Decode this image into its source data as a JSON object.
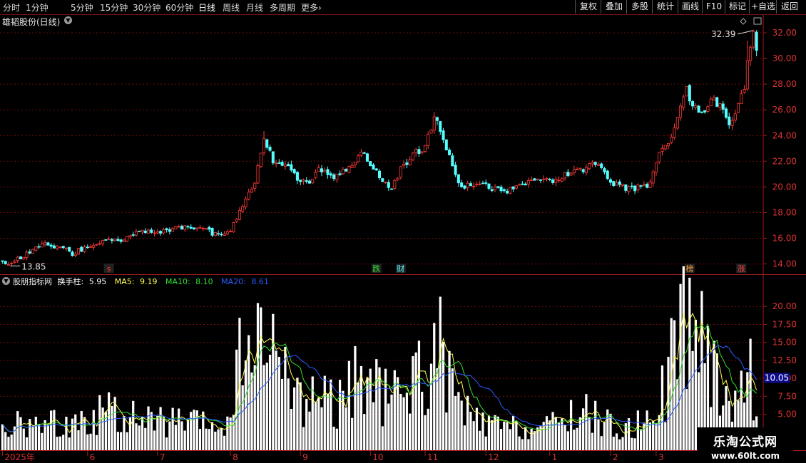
{
  "toolbar": {
    "periods": [
      "分时",
      "1分钟",
      "5分钟",
      "15分钟",
      "30分钟",
      "60分钟",
      "日线",
      "周线",
      "月线",
      "多周期",
      "更多"
    ],
    "active_period": "日线",
    "more_arrow": "›",
    "right_buttons": [
      "复权",
      "叠加",
      "多股",
      "统计",
      "画线",
      "F10",
      "标记",
      "+自选",
      "返回"
    ]
  },
  "stock_title": "雄韬股份(日线)",
  "dropdown_icon": "chevron-down-icon",
  "indicator": {
    "source": "股朋指标网",
    "name": "换手柱:",
    "value": "5.95",
    "ma5_label": "MA5:",
    "ma5": "9.19",
    "ma10_label": "MA10:",
    "ma10": "8.10",
    "ma20_label": "MA20:",
    "ma20": "8.61"
  },
  "watermark": {
    "name": "乐淘公式网",
    "url": "www.60lt.com"
  },
  "colors": {
    "up": "#ff3b3b",
    "down": "#54ffff",
    "grid": "#6e0d0d",
    "axis": "#a51c1c",
    "ma5": "#ffff55",
    "ma10": "#33dd33",
    "ma20": "#2a5bff",
    "bar": "#ffffff"
  },
  "chart_data": [
    {
      "type": "candlestick",
      "title": "雄韬股份(日线)",
      "ylim": [
        13.2,
        33.0
      ],
      "y_ticks": [
        "32.00",
        "30.00",
        "28.00",
        "26.00",
        "24.00",
        "22.00",
        "20.00",
        "18.00",
        "16.00",
        "14.00"
      ],
      "y_tick_values": [
        32,
        30,
        28,
        26,
        24,
        22,
        20,
        18,
        16,
        14
      ],
      "x_ticks": [
        "2025年",
        "6",
        "7",
        "8",
        "9",
        "10",
        "11",
        "12",
        "1",
        "2",
        "3"
      ],
      "x_tick_index": [
        0,
        28,
        51,
        75,
        98,
        121,
        139,
        159,
        180,
        200,
        215
      ],
      "max_label": "32.39",
      "min_label": "13.85",
      "markers": [
        {
          "index": 35,
          "label": "s",
          "color": "#ff3b3b"
        },
        {
          "index": 123,
          "label": "跌",
          "color": "#33dd33"
        },
        {
          "index": 131,
          "label": "财",
          "color": "#54ffff"
        },
        {
          "index": 226,
          "label": "榜",
          "color": "#ff9f3b"
        },
        {
          "index": 243,
          "label": "涨",
          "color": "#ff3b3b"
        }
      ],
      "anchors": [
        [
          0,
          14.2
        ],
        [
          2,
          13.9
        ],
        [
          8,
          14.8
        ],
        [
          14,
          15.6
        ],
        [
          20,
          15.2
        ],
        [
          23,
          14.8
        ],
        [
          28,
          15.4
        ],
        [
          34,
          15.9
        ],
        [
          40,
          15.9
        ],
        [
          46,
          16.6
        ],
        [
          52,
          16.5
        ],
        [
          58,
          16.8
        ],
        [
          64,
          16.8
        ],
        [
          72,
          16.2
        ],
        [
          75,
          16.6
        ],
        [
          79,
          18.5
        ],
        [
          83,
          20.5
        ],
        [
          86,
          23.8
        ],
        [
          89,
          22.0
        ],
        [
          92,
          21.8
        ],
        [
          95,
          21.5
        ],
        [
          98,
          20.4
        ],
        [
          101,
          20.5
        ],
        [
          104,
          21.5
        ],
        [
          108,
          20.8
        ],
        [
          113,
          21.2
        ],
        [
          118,
          22.8
        ],
        [
          122,
          21.5
        ],
        [
          125,
          20.5
        ],
        [
          128,
          19.8
        ],
        [
          131,
          21.5
        ],
        [
          135,
          22.5
        ],
        [
          139,
          23.2
        ],
        [
          142,
          25.5
        ],
        [
          145,
          23.8
        ],
        [
          148,
          21.5
        ],
        [
          151,
          20.0
        ],
        [
          155,
          20.3
        ],
        [
          160,
          20.0
        ],
        [
          165,
          19.6
        ],
        [
          170,
          20.1
        ],
        [
          175,
          20.6
        ],
        [
          180,
          20.4
        ],
        [
          185,
          20.9
        ],
        [
          190,
          21.3
        ],
        [
          193,
          21.7
        ],
        [
          197,
          21.5
        ],
        [
          201,
          20.2
        ],
        [
          206,
          19.9
        ],
        [
          210,
          19.9
        ],
        [
          213,
          20.3
        ],
        [
          216,
          22.5
        ],
        [
          220,
          24.0
        ],
        [
          223,
          26.5
        ],
        [
          225,
          27.8
        ],
        [
          227,
          26.2
        ],
        [
          230,
          25.6
        ],
        [
          233,
          26.8
        ],
        [
          236,
          26.5
        ],
        [
          239,
          25.0
        ],
        [
          242,
          26.5
        ],
        [
          244,
          27.5
        ],
        [
          245,
          29.5
        ],
        [
          247,
          31.8
        ],
        [
          248,
          30.8
        ]
      ]
    },
    {
      "type": "bar",
      "title": "换手柱",
      "ylim": [
        0,
        22.5
      ],
      "y_ticks": [
        "20.00",
        "17.50",
        "15.00",
        "12.50",
        "10.00",
        "7.50",
        "5.00"
      ],
      "y_tick_values": [
        20,
        17.5,
        15,
        12.5,
        10,
        7.5,
        5
      ],
      "current_value_label": "10.05",
      "current_value": 10.05,
      "series": [
        {
          "name": "MA5",
          "color": "#ffff55",
          "period": 5
        },
        {
          "name": "MA10",
          "color": "#33dd33",
          "period": 10
        },
        {
          "name": "MA20",
          "color": "#2a5bff",
          "period": 20
        }
      ],
      "anchors": [
        [
          0,
          3.5
        ],
        [
          10,
          3.0
        ],
        [
          20,
          3.6
        ],
        [
          30,
          4.0
        ],
        [
          35,
          5.4
        ],
        [
          40,
          4.3
        ],
        [
          50,
          3.8
        ],
        [
          60,
          3.5
        ],
        [
          70,
          3.2
        ],
        [
          75,
          3.5
        ],
        [
          78,
          11.5
        ],
        [
          80,
          15.0
        ],
        [
          83,
          13.5
        ],
        [
          86,
          12.0
        ],
        [
          90,
          11.0
        ],
        [
          95,
          8.5
        ],
        [
          100,
          6.8
        ],
        [
          105,
          7.8
        ],
        [
          110,
          5.8
        ],
        [
          113,
          6.5
        ],
        [
          117,
          10.0
        ],
        [
          121,
          8.2
        ],
        [
          124,
          7.5
        ],
        [
          128,
          6.5
        ],
        [
          132,
          7.8
        ],
        [
          136,
          10.5
        ],
        [
          140,
          9.5
        ],
        [
          144,
          13.0
        ],
        [
          147,
          9.0
        ],
        [
          150,
          6.0
        ],
        [
          155,
          3.8
        ],
        [
          160,
          3.2
        ],
        [
          170,
          2.8
        ],
        [
          180,
          3.0
        ],
        [
          185,
          4.2
        ],
        [
          190,
          5.2
        ],
        [
          195,
          4.3
        ],
        [
          200,
          3.2
        ],
        [
          205,
          2.5
        ],
        [
          210,
          3.5
        ],
        [
          213,
          5.5
        ],
        [
          218,
          8.0
        ],
        [
          222,
          14.5
        ],
        [
          224,
          19.0
        ],
        [
          226,
          18.0
        ],
        [
          228,
          15.0
        ],
        [
          232,
          12.0
        ],
        [
          236,
          9.0
        ],
        [
          240,
          7.0
        ],
        [
          243,
          7.5
        ],
        [
          246,
          10.5
        ],
        [
          248,
          6.0
        ]
      ]
    }
  ]
}
